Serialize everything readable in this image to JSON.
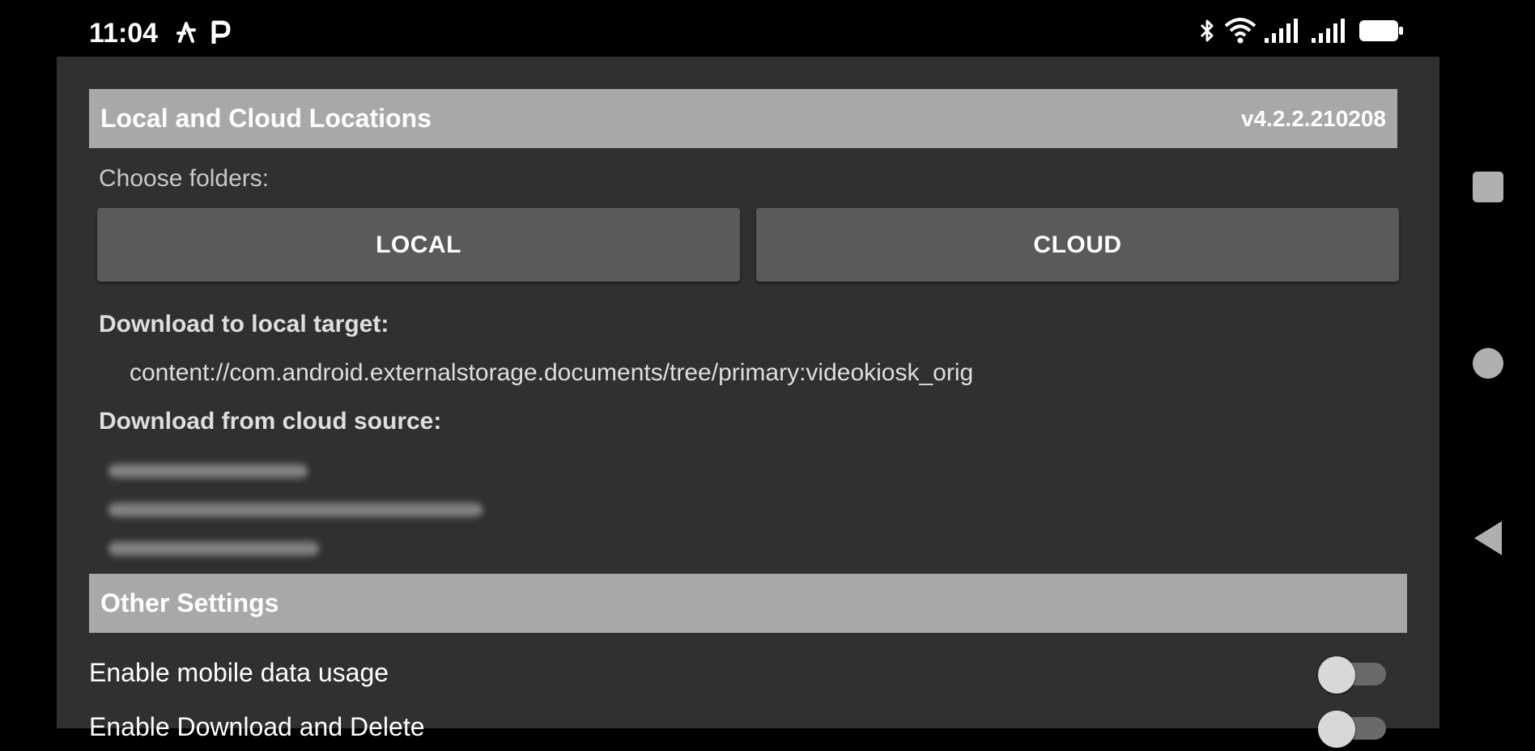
{
  "status_bar": {
    "time": "11:04",
    "left_icons": [
      "usb-debug-icon",
      "parking-icon"
    ],
    "right_icons": [
      "bluetooth-icon",
      "wifi-icon",
      "signal-icon",
      "signal-icon-2",
      "battery-icon"
    ]
  },
  "locations_section": {
    "title": "Local and Cloud Locations",
    "version": "v4.2.2.210208",
    "choose_label": "Choose folders:",
    "local_button": "LOCAL",
    "cloud_button": "CLOUD",
    "local_target_label": "Download to local target:",
    "local_target_value": "content://com.android.externalstorage.documents/tree/primary:videokiosk_orig",
    "cloud_source_label": "Download from cloud source:"
  },
  "other_settings": {
    "title": "Other Settings",
    "items": [
      {
        "label": "Enable mobile data usage",
        "enabled": false
      },
      {
        "label": "Enable Download and Delete",
        "enabled": false
      }
    ]
  },
  "nav_bar": {
    "buttons": [
      "recents-icon",
      "home-icon",
      "back-icon"
    ]
  },
  "colors": {
    "background": "#000000",
    "panel": "#303030",
    "header": "#a8a8a8",
    "button": "#5a5a5a"
  }
}
